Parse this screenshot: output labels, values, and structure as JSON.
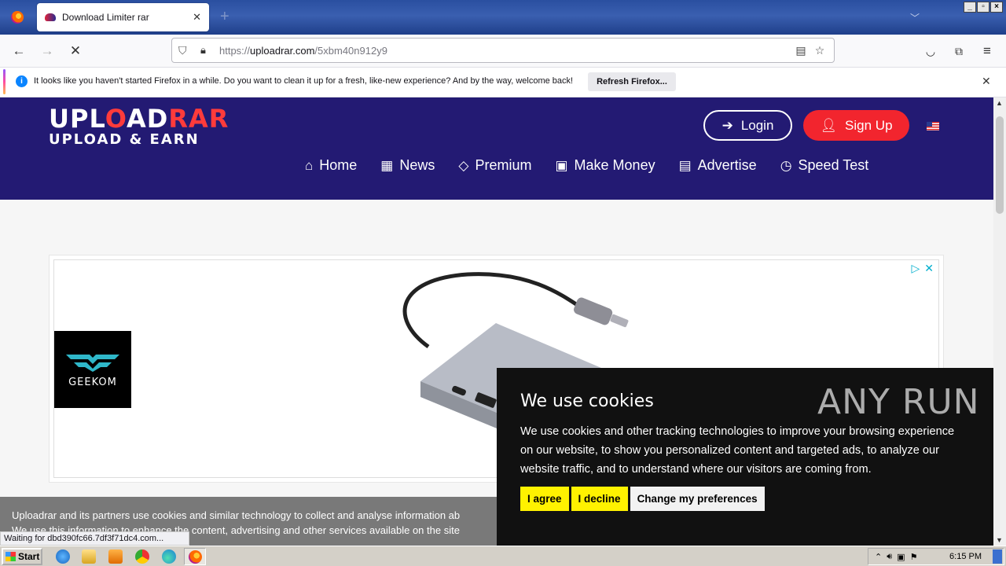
{
  "browser": {
    "tab_title": "Download Limiter rar",
    "tab_close": "✕",
    "new_tab": "+",
    "url_prefix": "https://",
    "url_domain": "uploadrar.com",
    "url_path": "/5xbm40n912y9",
    "status_text": "Waiting for dbd390fc66.7df3f71dc4.com..."
  },
  "notification": {
    "message": "It looks like you haven't started Firefox in a while. Do you want to clean it up for a fresh, like-new experience? And by the way, welcome back!",
    "button": "Refresh Firefox..."
  },
  "site": {
    "logo_main_a": "UPL",
    "logo_main_b": "O",
    "logo_main_c": "AD",
    "logo_main_d": "RAR",
    "logo_sub": "UPLOAD & EARN",
    "login": "Login",
    "signup": "Sign Up",
    "nav": {
      "home": "Home",
      "news": "News",
      "premium": "Premium",
      "make_money": "Make Money",
      "advertise": "Advertise",
      "speed_test": "Speed Test"
    }
  },
  "ad": {
    "brand": "GEEKOM"
  },
  "consent_bar": {
    "line1": "Uploadrar and its partners use cookies and similar technology to collect and analyse information ab",
    "line2": "We use this information to enhance the content, advertising and other services available on the site"
  },
  "cookie_dialog": {
    "title": "We use cookies",
    "body": "We use cookies and other tracking technologies to improve your browsing experience on our website, to show you personalized content and targeted ads, to analyze our website traffic, and to understand where our visitors are coming from.",
    "agree": "I agree",
    "decline": "I decline",
    "preferences": "Change my preferences"
  },
  "watermark": "ANY RUN",
  "taskbar": {
    "start": "Start",
    "clock": "6:15 PM"
  }
}
